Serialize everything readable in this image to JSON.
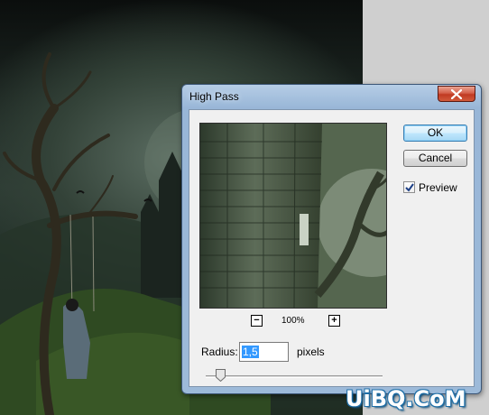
{
  "dialog": {
    "title": "High Pass",
    "zoom": {
      "value": "100%",
      "minus": "−",
      "plus": "+"
    },
    "buttons": {
      "ok": "OK",
      "cancel": "Cancel"
    },
    "preview_checkbox": {
      "label": "Preview",
      "checked": true
    },
    "radius": {
      "label": "Radius:",
      "value": "1,5",
      "unit": "pixels"
    }
  },
  "watermark": "UiBQ.CoM",
  "colors": {
    "titlebar": "#9dbad9",
    "close_button": "#c13a22",
    "selection": "#3399ff",
    "ok_border": "#3c7fb1"
  },
  "icons": {
    "close": "close-icon",
    "checkbox": "checkmark-icon",
    "slider": "slider-thumb"
  }
}
